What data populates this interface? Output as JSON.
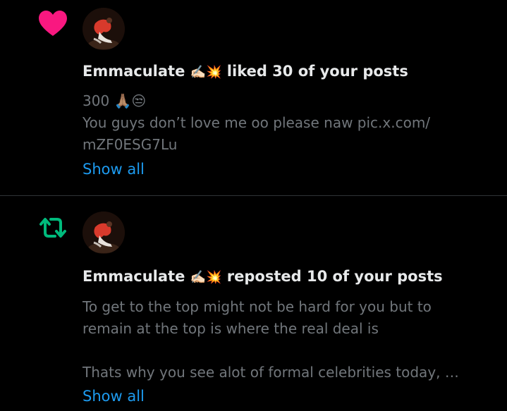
{
  "colors": {
    "background": "#000000",
    "like_pink": "#f91880",
    "repost_green": "#00ba7c",
    "link_blue": "#1d9bf0",
    "text_primary": "#e7e9ea",
    "text_secondary": "#71767b",
    "divider": "#2f3336"
  },
  "notifications": [
    {
      "type_icon": "heart-icon",
      "user_name": "Emmaculate",
      "user_emojis": "✍🏻💥",
      "action_text": "liked 30 of your posts",
      "body": "300 🙏🏽😒\nYou guys don’t love me oo please naw pic.x.com/\nmZF0ESG7Lu",
      "show_all_label": "Show all"
    },
    {
      "type_icon": "repost-icon",
      "user_name": "Emmaculate",
      "user_emojis": "✍🏻💥",
      "action_text": "reposted 10 of your posts",
      "body": "To get to the top might not be hard for you but to\nremain at the top is where the real deal is\n\nThats why you see alot of formal celebrities today, …",
      "show_all_label": "Show all"
    }
  ]
}
